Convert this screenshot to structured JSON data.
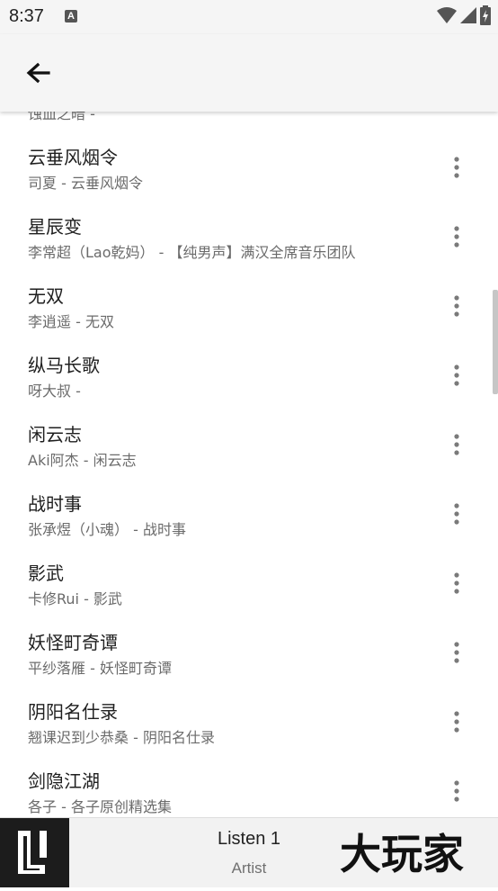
{
  "status_bar": {
    "time": "8:37",
    "notification_icon": "A"
  },
  "app_bar": {
    "back_icon": "arrow-back-icon"
  },
  "songs": [
    {
      "title": "",
      "subtitle": "蚀血之暗 -"
    },
    {
      "title": "云垂风烟令",
      "subtitle": "司夏 - 云垂风烟令"
    },
    {
      "title": "星辰变",
      "subtitle": "李常超（Lao乾妈） - 【纯男声】满汉全席音乐团队"
    },
    {
      "title": "无双",
      "subtitle": "李逍遥 - 无双"
    },
    {
      "title": "纵马长歌",
      "subtitle": "呀大叔 -"
    },
    {
      "title": "闲云志",
      "subtitle": "Aki阿杰 - 闲云志"
    },
    {
      "title": "战时事",
      "subtitle": "张承煜（小魂） - 战时事"
    },
    {
      "title": "影武",
      "subtitle": "卡修Rui - 影武"
    },
    {
      "title": "妖怪町奇谭",
      "subtitle": "平纱落雁 - 妖怪町奇谭"
    },
    {
      "title": "阴阳名仕录",
      "subtitle": "翘课迟到少恭桑 - 阴阳名仕录"
    },
    {
      "title": "剑隐江湖",
      "subtitle": "各子 - 各子原创精选集"
    }
  ],
  "player": {
    "track": "Listen 1",
    "artist": "Artist",
    "watermark": "大玩家"
  },
  "colors": {
    "appbar": "#f5f5f5",
    "text_primary": "#1f1f1f",
    "text_secondary": "#6b6b6b",
    "cover": "#1c1c1c"
  }
}
